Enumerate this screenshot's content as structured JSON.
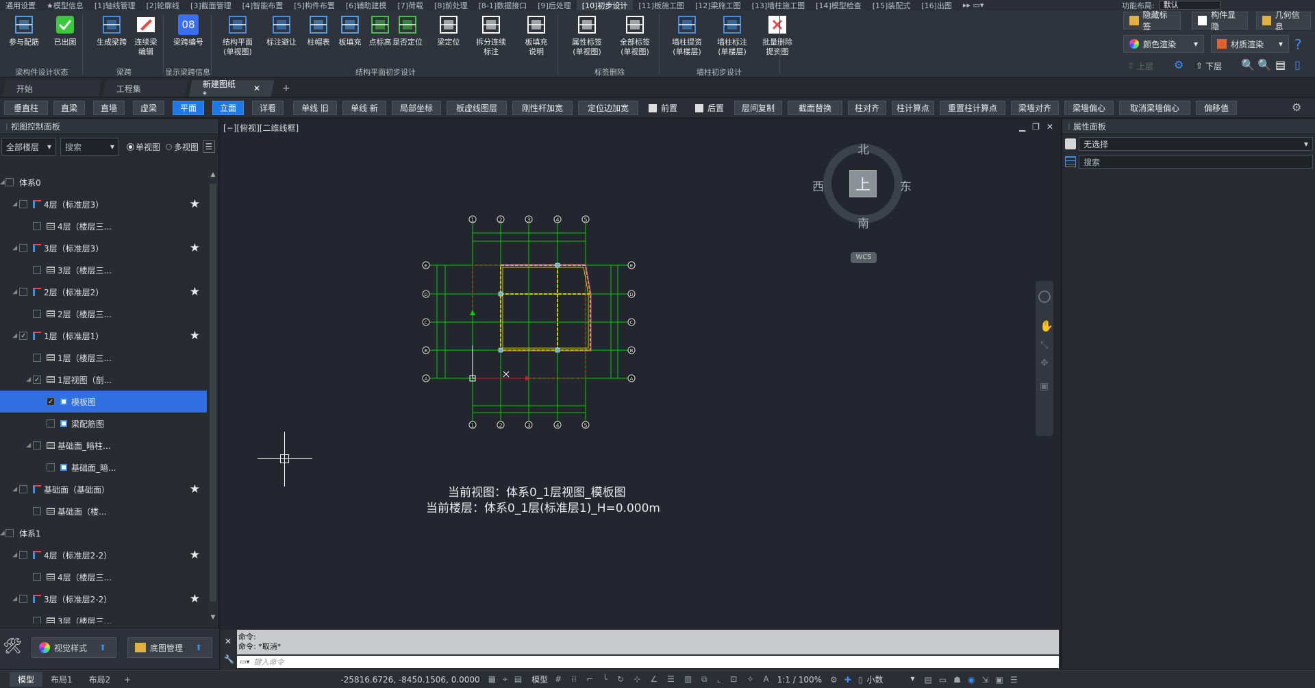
{
  "menu": [
    "通用设置",
    "★模型信息",
    "[1]轴线管理",
    "[2]轮廓线",
    "[3]截面管理",
    "[4]智能布置",
    "[5]构件布置",
    "[6]辅助建模",
    "[7]荷载",
    "[8]前处理",
    "[8-1]数据接口",
    "[9]后处理",
    "[10]初步设计",
    "[11]板施工图",
    "[12]梁施工图",
    "[13]墙柱施工图",
    "[14]模型检查",
    "[15]装配式",
    "[16]出图"
  ],
  "menu_active_index": 12,
  "layout": {
    "label": "功能布局:",
    "value": "默认"
  },
  "ribbon": {
    "buttons": [
      {
        "label": "参与配筋"
      },
      {
        "label": "已出图"
      },
      {
        "label": "生成梁跨"
      },
      {
        "label": "连续梁\n编辑"
      },
      {
        "label": "梁跨编号"
      },
      {
        "label": "结构平面\n(单视图)"
      },
      {
        "label": "标注避让"
      },
      {
        "label": "柱帽表"
      },
      {
        "label": "板填充"
      },
      {
        "label": "点标高"
      },
      {
        "label": "是否定位"
      },
      {
        "label": "梁定位"
      },
      {
        "label": "拆分连续标注"
      },
      {
        "label": "板填充\n说明"
      },
      {
        "label": "属性标签\n(单视图)"
      },
      {
        "label": "全部标签\n(单视图)"
      },
      {
        "label": "墙柱提资\n(单楼层)"
      },
      {
        "label": "墙柱标注\n(单楼层)"
      },
      {
        "label": "批量删除\n提资图"
      }
    ],
    "groups": [
      "梁构件设计状态",
      "梁跨",
      "显示梁跨信息",
      "结构平面初步设计",
      "标签删除",
      "墙柱初步设计"
    ],
    "right": {
      "hide_label": "隐藏标签",
      "comp_show": "构件显隐",
      "geo_info": "几何信息",
      "color_render": "颜色渲染",
      "material_render": "材质渲染",
      "up_layer": "上层",
      "down_layer": "下层"
    },
    "badge_08": "08"
  },
  "tabs": [
    {
      "label": "开始",
      "active": false
    },
    {
      "label": "工程集",
      "active": false
    },
    {
      "label": "新建图纸*",
      "active": true,
      "closable": true
    }
  ],
  "toolbar": [
    "垂直柱",
    "直梁",
    "直墙",
    "虚梁",
    "平面",
    "立面",
    "详看",
    "单线 旧",
    "单线 新",
    "局部坐标",
    "板虚线图层",
    "刚性杆加宽",
    "定位边加宽",
    "前置",
    "后置",
    "层间复制",
    "截面替换",
    "柱对齐",
    "柱计算点",
    "重置柱计算点",
    "梁墙对齐",
    "梁墙偏心",
    "取消梁墙偏心",
    "偏移值"
  ],
  "toolbar_blue": [
    "平面",
    "立面"
  ],
  "left_panel": {
    "title": "视图控制面板",
    "floor_select": "全部楼层",
    "search_placeholder": "搜索",
    "single_view": "单视图",
    "multi_view": "多视图",
    "tree": [
      {
        "label": "体系0",
        "level": 0
      },
      {
        "label": "4层（标准层3）",
        "level": 1,
        "star": true
      },
      {
        "label": "4层（楼层三...",
        "level": 2
      },
      {
        "label": "3层（标准层3）",
        "level": 1,
        "star": true
      },
      {
        "label": "3层（楼层三...",
        "level": 2
      },
      {
        "label": "2层（标准层2）",
        "level": 1,
        "star": true
      },
      {
        "label": "2层（楼层三...",
        "level": 2
      },
      {
        "label": "1层（标准层1）",
        "level": 1,
        "star": true
      },
      {
        "label": "1层（楼层三...",
        "level": 2
      },
      {
        "label": "1层视图（剖...",
        "level": 2
      },
      {
        "label": "模板图",
        "level": 3,
        "selected": true
      },
      {
        "label": "梁配筋图",
        "level": 3
      },
      {
        "label": "基础面_暗柱...",
        "level": 2
      },
      {
        "label": "基础面_暗...",
        "level": 3
      },
      {
        "label": "基础面（基础面）",
        "level": 1,
        "star": true
      },
      {
        "label": "基础面（楼...",
        "level": 2
      },
      {
        "label": "体系1",
        "level": 0
      },
      {
        "label": "4层（标准层2-2）",
        "level": 1,
        "star": true
      },
      {
        "label": "4层（楼层三...",
        "level": 2
      },
      {
        "label": "3层（标准层2-2）",
        "level": 1,
        "star": true
      },
      {
        "label": "3层（楼层三...",
        "level": 2
      }
    ],
    "bottom": {
      "visual_style": "视觉样式",
      "base_map": "底图管理"
    }
  },
  "canvas": {
    "view_label": "[−][俯视][二维线框]",
    "compass": {
      "north": "北",
      "south": "南",
      "east": "东",
      "west": "西",
      "top": "上",
      "wcs": "WCS"
    },
    "axis_numbers": [
      "1",
      "2",
      "3",
      "4",
      "5"
    ],
    "axis_letters": [
      "E",
      "D",
      "C",
      "B",
      "A"
    ],
    "current_view": "当前视图：体系0_1层视图_模板图",
    "current_floor": "当前楼层：体系0_1层(标准层1)_H=0.000m"
  },
  "right_panel": {
    "title": "属性面板",
    "selection": "无选择",
    "search_placeholder": "搜索"
  },
  "command": {
    "line1": "命令:",
    "line2": "命令: *取消*",
    "placeholder": "键入命令"
  },
  "status": {
    "tabs": [
      "模型",
      "布局1",
      "布局2"
    ],
    "coords": "-25816.6726, -8450.1506, 0.0000",
    "model": "模型",
    "scale": "1:1 / 100%",
    "decimal": "小数"
  },
  "colors": {
    "accent": "#1e78e6",
    "grid_green": "#00d000",
    "wall_yellow": "#d8c400",
    "beam_magenta": "#e040e0"
  }
}
